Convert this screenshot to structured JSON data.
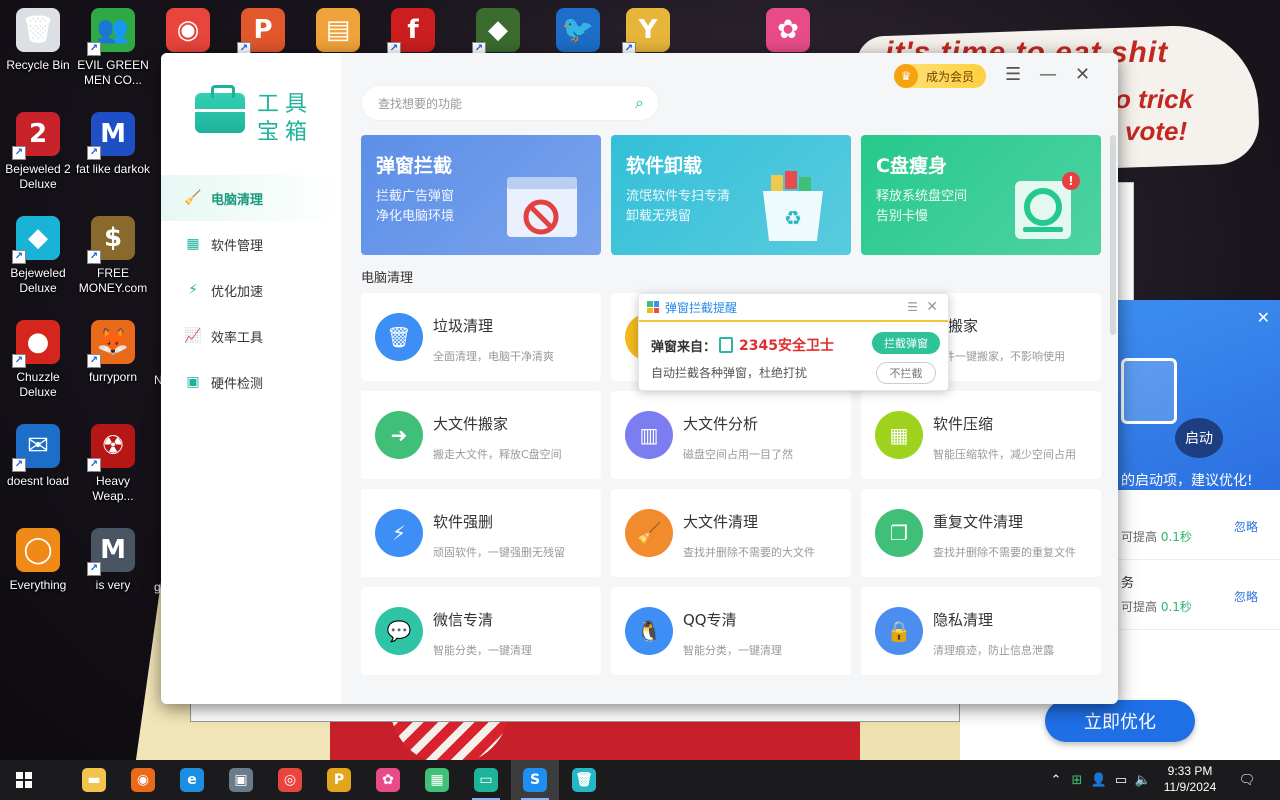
{
  "desktop": {
    "icons": [
      {
        "label": "Recycle Bin",
        "glyph": "🗑",
        "color": "#dcdfe3",
        "icon": "recycle-bin-icon",
        "shortcut": false
      },
      {
        "label": "EVIL GREEN MEN CO...",
        "glyph": "👥",
        "color": "#2fa846",
        "icon": "people-icon",
        "shortcut": true
      },
      {
        "label": "",
        "glyph": "◉",
        "color": "#e8453c",
        "icon": "chrome-icon",
        "shortcut": false
      },
      {
        "label": "",
        "glyph": "P",
        "color": "#e2572c",
        "icon": "paint-icon",
        "shortcut": true
      },
      {
        "label": "",
        "glyph": "▤",
        "color": "#f0a33a",
        "icon": "folder-icon",
        "shortcut": false
      },
      {
        "label": "",
        "glyph": "f",
        "color": "#cc1e1e",
        "icon": "flash-icon",
        "shortcut": true
      },
      {
        "label": "",
        "glyph": "◆",
        "color": "#3b6b2e",
        "icon": "shield-icon",
        "shortcut": true
      },
      {
        "label": "",
        "glyph": "🐦",
        "color": "#1c6ec9",
        "icon": "thunderbird-icon",
        "shortcut": false
      },
      {
        "label": "",
        "glyph": "Y",
        "color": "#e6b53a",
        "icon": "yashima-icon",
        "shortcut": true
      },
      {
        "label": "",
        "glyph": "✿",
        "color": "#e84c88",
        "icon": "flower-app-icon",
        "shortcut": false
      },
      {
        "label": "Bejeweled 2 Deluxe",
        "glyph": "2",
        "color": "#c8232b",
        "icon": "bejeweled-2-icon",
        "shortcut": true
      },
      {
        "label": "fat like darkok",
        "glyph": "M",
        "color": "#1f4fc4",
        "icon": "mpl-icon",
        "shortcut": true
      },
      {
        "label": "Bejeweled Deluxe",
        "glyph": "◆",
        "color": "#1ab3d8",
        "icon": "bejeweled-icon",
        "shortcut": true
      },
      {
        "label": "FREE MONEY.com",
        "glyph": "$",
        "color": "#8a6a2c",
        "icon": "money-bag-icon",
        "shortcut": true
      },
      {
        "label": "Chuzzle Deluxe",
        "glyph": "●",
        "color": "#d4261c",
        "icon": "chuzzle-icon",
        "shortcut": true
      },
      {
        "label": "furryporn",
        "glyph": "🦊",
        "color": "#e86a1a",
        "icon": "firefox-icon",
        "shortcut": true
      },
      {
        "label": "doesnt load",
        "glyph": "✉",
        "color": "#1c6ec9",
        "icon": "thunderbird-icon",
        "shortcut": true
      },
      {
        "label": "Heavy Weap...",
        "glyph": "☢",
        "color": "#b51616",
        "icon": "radiation-icon",
        "shortcut": true
      },
      {
        "label": "Everything",
        "glyph": "◯",
        "color": "#f08a16",
        "icon": "search-ring-icon",
        "shortcut": false
      },
      {
        "label": "is very",
        "glyph": "M",
        "color": "#4a5563",
        "icon": "mpl-shield-icon",
        "shortcut": true
      }
    ],
    "meme": {
      "line1": "it's time to eat shit",
      "line2": "o trick",
      "line3": "vote!"
    },
    "left_edge_labels": [
      "N",
      "g"
    ]
  },
  "toolbox": {
    "logo_text": "工具宝箱",
    "search_placeholder": "查找想要的功能",
    "vip_label": "成为会员",
    "nav": [
      {
        "label": "电脑清理",
        "glyph": "🧹",
        "active": true,
        "icon": "broom-icon"
      },
      {
        "label": "软件管理",
        "glyph": "▦",
        "active": false,
        "icon": "grid-icon"
      },
      {
        "label": "优化加速",
        "glyph": "⚡",
        "active": false,
        "icon": "bolt-icon"
      },
      {
        "label": "效率工具",
        "glyph": "📈",
        "active": false,
        "icon": "chart-icon"
      },
      {
        "label": "硬件检测",
        "glyph": "▣",
        "active": false,
        "icon": "chip-icon"
      }
    ],
    "banners": [
      {
        "title": "弹窗拦截",
        "sub1": "拦截广告弹窗",
        "sub2": "净化电脑环境",
        "bg": "#5c8fe8",
        "icon": "popup-block-icon"
      },
      {
        "title": "软件卸载",
        "sub1": "流氓软件专扫专清",
        "sub2": "卸载无残留",
        "bg": "#33c0d8",
        "icon": "uninstall-icon"
      },
      {
        "title": "C盘瘦身",
        "sub1": "释放系统盘空间",
        "sub2": "告别卡慢",
        "bg": "#26c98d",
        "icon": "disk-slim-icon"
      }
    ],
    "section_title": "电脑清理",
    "tiles": [
      {
        "title": "垃圾清理",
        "desc": "全面清理，电脑干净清爽",
        "color": "#3d8ef5",
        "glyph": "🗑",
        "icon": "trash-icon"
      },
      {
        "title": "",
        "desc": "",
        "color": "#f2b81c",
        "glyph": "",
        "icon": "hidden-tile-icon"
      },
      {
        "title": "件搬家",
        "desc": "软件一键搬家，不影响使用",
        "color": "#3d8ef5",
        "glyph": "",
        "icon": "move-icon"
      },
      {
        "title": "大文件搬家",
        "desc": "搬走大文件，释放C盘空间",
        "color": "#3fbf78",
        "glyph": "➜",
        "icon": "file-move-icon"
      },
      {
        "title": "大文件分析",
        "desc": "磁盘空间占用一目了然",
        "color": "#7b7df0",
        "glyph": "▥",
        "icon": "analysis-icon"
      },
      {
        "title": "软件压缩",
        "desc": "智能压缩软件，减少空间占用",
        "color": "#9fd21c",
        "glyph": "▦",
        "icon": "compress-icon"
      },
      {
        "title": "软件强删",
        "desc": "顽固软件，一键强删无残留",
        "color": "#3d8ef5",
        "glyph": "⚡",
        "icon": "force-delete-icon"
      },
      {
        "title": "大文件清理",
        "desc": "查找并删除不需要的大文件",
        "color": "#f28a2e",
        "glyph": "🧹",
        "icon": "broom-icon"
      },
      {
        "title": "重复文件清理",
        "desc": "查找并删除不需要的重复文件",
        "color": "#3fbf78",
        "glyph": "❐",
        "icon": "duplicate-icon"
      },
      {
        "title": "微信专清",
        "desc": "智能分类，一键清理",
        "color": "#2fc4a6",
        "glyph": "💬",
        "icon": "wechat-icon"
      },
      {
        "title": "QQ专清",
        "desc": "智能分类，一键清理",
        "color": "#3d8ef5",
        "glyph": "🐧",
        "icon": "qq-icon"
      },
      {
        "title": "隐私清理",
        "desc": "清理痕迹，防止信息泄露",
        "color": "#4c8ef0",
        "glyph": "🔒",
        "icon": "lock-icon"
      }
    ]
  },
  "popup": {
    "title": "弹窗拦截提醒",
    "from_label": "弹窗来自：",
    "source": "2345安全卫士",
    "desc": "自动拦截各种弹窗，杜绝打扰",
    "block_button": "拦截弹窗",
    "allow_button": "不拦截"
  },
  "optimizer": {
    "launch_label": "启动",
    "suggest": "的启动项，建议优化!",
    "rows": [
      {
        "title": "",
        "prefix": "可提高",
        "gain": "0.1秒",
        "ignore": "忽略"
      },
      {
        "title": "务",
        "prefix": "可提高",
        "gain": "0.1秒",
        "ignore": "忽略"
      }
    ],
    "cta": "立即优化"
  },
  "taskbar": {
    "apps": [
      {
        "name": "file-explorer",
        "glyph": "▬",
        "color": "#f2c44b",
        "active": false,
        "running": false
      },
      {
        "name": "firefox",
        "glyph": "◉",
        "color": "#e86a1a",
        "active": false,
        "running": false
      },
      {
        "name": "edge",
        "glyph": "e",
        "color": "#1a8fe0",
        "active": false,
        "running": false
      },
      {
        "name": "window-app",
        "glyph": "▣",
        "color": "#6a7b8c",
        "active": false,
        "running": false
      },
      {
        "name": "chrome",
        "glyph": "◎",
        "color": "#e8453c",
        "active": false,
        "running": false
      },
      {
        "name": "paint",
        "glyph": "P",
        "color": "#e2a61c",
        "active": false,
        "running": false
      },
      {
        "name": "flower-app",
        "glyph": "✿",
        "color": "#e84c88",
        "active": false,
        "running": false
      },
      {
        "name": "store-app",
        "glyph": "▦",
        "color": "#3fbf78",
        "active": false,
        "running": false
      },
      {
        "name": "toolbox",
        "glyph": "▭",
        "color": "#1db39a",
        "active": false,
        "running": true
      },
      {
        "name": "safety-app",
        "glyph": "S",
        "color": "#1f8ef0",
        "active": true,
        "running": true
      },
      {
        "name": "recycle-app",
        "glyph": "🗑",
        "color": "#27b6c6",
        "active": false,
        "running": false
      }
    ],
    "time": "9:33 PM",
    "date": "11/9/2024"
  }
}
